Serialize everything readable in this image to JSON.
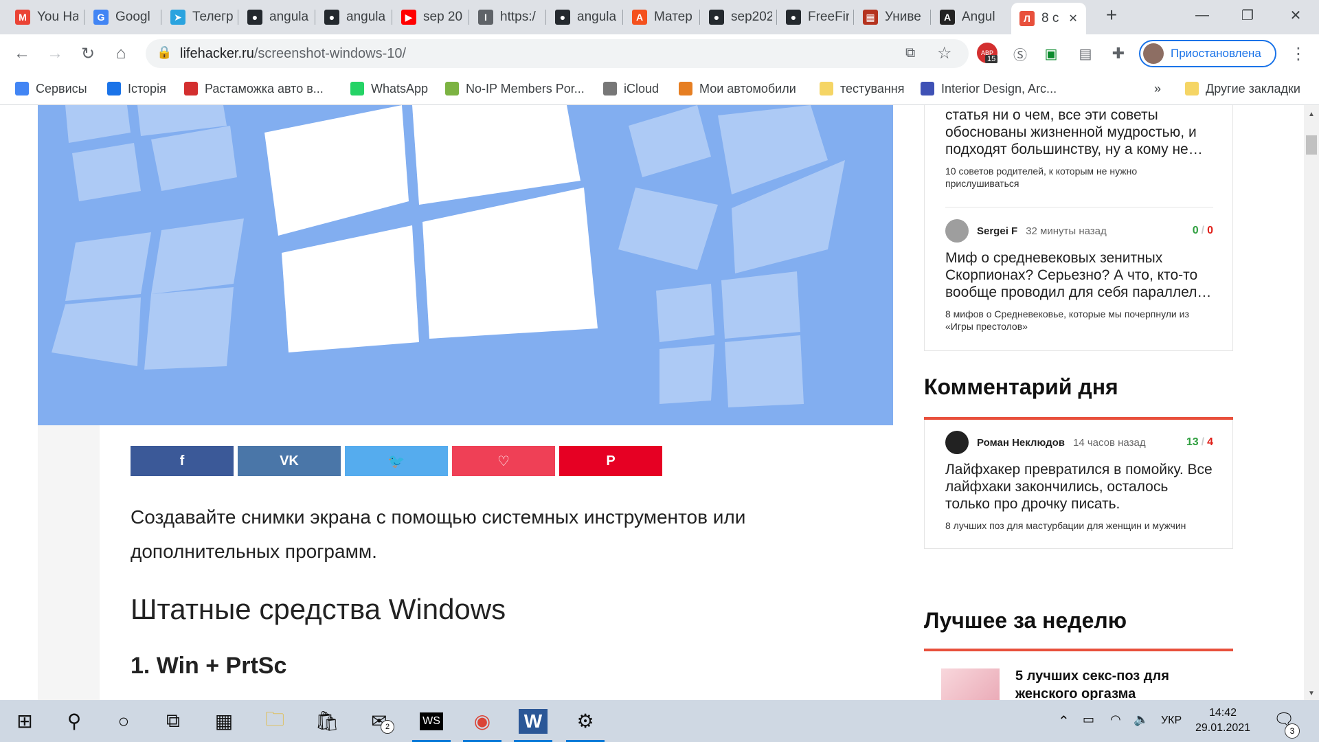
{
  "tabs": [
    {
      "label": "You Ha",
      "icon": "gmail-icon",
      "color": "#ea4335",
      "glyph": "M"
    },
    {
      "label": "Googl",
      "icon": "google-translate-icon",
      "color": "#4285f4",
      "glyph": "G"
    },
    {
      "label": "Телегр",
      "icon": "telegram-icon",
      "color": "#2aa3df",
      "glyph": "➤"
    },
    {
      "label": "angula",
      "icon": "github-icon",
      "color": "#24292e",
      "glyph": "●"
    },
    {
      "label": "angula",
      "icon": "github-icon",
      "color": "#24292e",
      "glyph": "●"
    },
    {
      "label": "sep 20",
      "icon": "youtube-icon",
      "color": "#ff0000",
      "glyph": "▶"
    },
    {
      "label": "https:/",
      "icon": "page-icon",
      "color": "#5f6368",
      "glyph": "I"
    },
    {
      "label": "angula",
      "icon": "github-icon",
      "color": "#24292e",
      "glyph": "●"
    },
    {
      "label": "Матер",
      "icon": "material-icon",
      "color": "#f4511e",
      "glyph": "A"
    },
    {
      "label": "sep202",
      "icon": "github-icon",
      "color": "#24292e",
      "glyph": "●"
    },
    {
      "label": "FreeFir",
      "icon": "github-icon",
      "color": "#24292e",
      "glyph": "●"
    },
    {
      "label": "Униве",
      "icon": "university-icon",
      "color": "#b5331f",
      "glyph": "▦"
    },
    {
      "label": "Angul",
      "icon": "angular-icon",
      "color": "#222222",
      "glyph": "A"
    },
    {
      "label": "8 с",
      "icon": "lifehacker-icon",
      "color": "#e8503c",
      "glyph": "Л",
      "active": true
    }
  ],
  "toolbar": {
    "url_host": "lifehacker.ru",
    "url_path": "/screenshot-windows-10/",
    "profile_label": "Приостановлена",
    "adblock_badge": "15"
  },
  "bookmarks": [
    {
      "label": "Сервисы",
      "icon": "apps-grid-icon",
      "color": "#4285f4"
    },
    {
      "label": "Історія",
      "icon": "history-icon",
      "color": "#1a73e8"
    },
    {
      "label": "Растаможка авто в...",
      "icon": "customs-icon",
      "color": "#d32f2f"
    },
    {
      "label": "WhatsApp",
      "icon": "whatsapp-icon",
      "color": "#25d366"
    },
    {
      "label": "No-IP Members Por...",
      "icon": "noip-icon",
      "color": "#7cb342"
    },
    {
      "label": "iCloud",
      "icon": "apple-icon",
      "color": "#777777"
    },
    {
      "label": "Мои автомобили",
      "icon": "cars-icon",
      "color": "#e67e22"
    },
    {
      "label": "тестування",
      "icon": "folder-icon",
      "color": "#f5d565"
    },
    {
      "label": "Interior Design, Arc...",
      "icon": "interior-icon",
      "color": "#3f51b5"
    },
    {
      "label": "Другие закладки",
      "icon": "folder-icon",
      "color": "#f5d565"
    }
  ],
  "article": {
    "share_buttons": [
      {
        "name": "facebook-share-button",
        "icon": "facebook-icon",
        "glyph": "f",
        "color": "#3b5998"
      },
      {
        "name": "vk-share-button",
        "icon": "vk-icon",
        "glyph": "VK",
        "color": "#4a76a8"
      },
      {
        "name": "twitter-share-button",
        "icon": "twitter-icon",
        "glyph": "🐦",
        "color": "#55acee"
      },
      {
        "name": "pocket-share-button",
        "icon": "pocket-icon",
        "glyph": "♡",
        "color": "#ef4056"
      },
      {
        "name": "pinterest-share-button",
        "icon": "pinterest-icon",
        "glyph": "P",
        "color": "#e60023"
      }
    ],
    "lead": "Создавайте снимки экрана с помощью системных инструментов или дополнительных программ.",
    "h2": "Штатные средства Windows",
    "h3": "1. Win + PrtSc"
  },
  "sidebar": {
    "comment_top_partial": {
      "text": "статья ни о чем, все эти советы обоснованы жизненной мудростью, и подходят большинству, ну а кому не…",
      "source": "10 советов родителей, к которым не нужно прислушиваться"
    },
    "comment_sergei": {
      "author": "Sergei F",
      "time": "32 минуты назад",
      "plus": "0",
      "minus": "0",
      "text": "Миф о средневековых зенитных Скорпионах? Серьезно? А что, кто-то вообще проводил для себя параллел…",
      "source": "8 мифов о Средневековье, которые мы почерпнули из «Игры престолов»"
    },
    "comment_of_day_title": "Комментарий дня",
    "comment_of_day": {
      "author": "Роман Неклюдов",
      "time": "14 часов назад",
      "plus": "13",
      "minus": "4",
      "text": "Лайфхакер превратился в помойку. Все лайфхаки закончились, осталось только про дрочку писать.",
      "source": "8 лучших поз для мастурбации для женщин и мужчин"
    },
    "best_week_title": "Лучшее за неделю",
    "best_week_item": "5 лучших секс-поз для женского оргазма"
  },
  "taskbar": {
    "apps": [
      {
        "name": "start-button",
        "icon": "windows-icon"
      },
      {
        "name": "search-button",
        "icon": "search-icon"
      },
      {
        "name": "cortana-button",
        "icon": "cortana-icon"
      },
      {
        "name": "task-view-button",
        "icon": "task-view-icon"
      },
      {
        "name": "calculator-app",
        "icon": "calculator-icon"
      },
      {
        "name": "file-explorer-app",
        "icon": "folder-icon"
      },
      {
        "name": "store-app",
        "icon": "store-icon"
      },
      {
        "name": "mail-app",
        "icon": "mail-icon",
        "badge": "2"
      },
      {
        "name": "webstorm-app",
        "icon": "webstorm-icon"
      },
      {
        "name": "chrome-app",
        "icon": "chrome-icon"
      },
      {
        "name": "word-app",
        "icon": "word-icon"
      },
      {
        "name": "settings-app",
        "icon": "gear-icon"
      }
    ],
    "language": "УКР",
    "time": "14:42",
    "date": "29.01.2021",
    "notifications_badge": "3"
  }
}
